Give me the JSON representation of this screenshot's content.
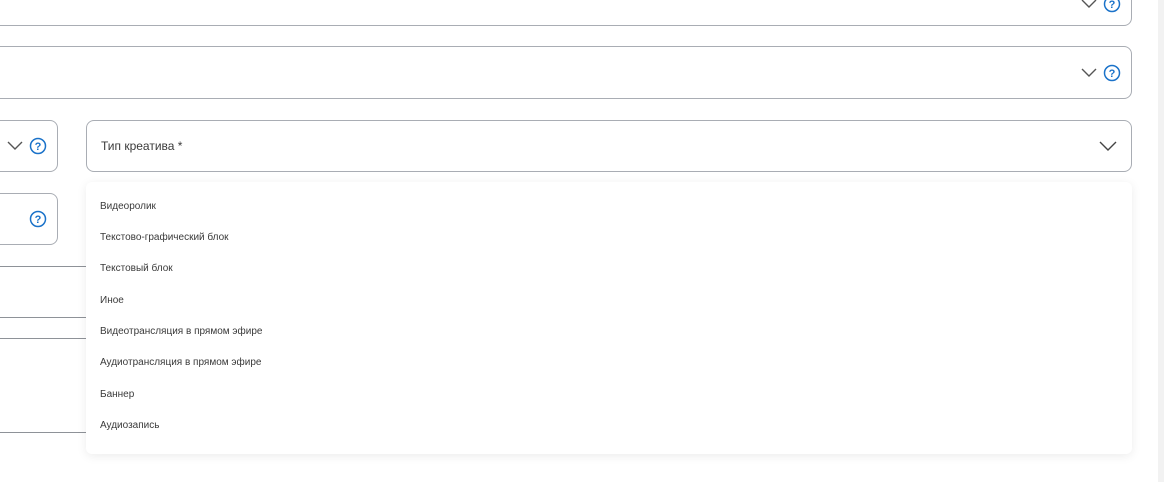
{
  "fields": {
    "top_field_partial": {
      "label": ""
    },
    "second_field": {
      "label": ""
    },
    "left_select_field": {
      "label": ""
    },
    "left_input_field": {
      "label": ""
    },
    "creative_type": {
      "label": "Тип креатива *"
    }
  },
  "dropdown": {
    "options": [
      "Видеоролик",
      "Текстово-графический блок",
      "Текстовый блок",
      "Иное",
      "Видеотрансляция в прямом эфире",
      "Аудиотрансляция в прямом эфире",
      "Баннер",
      "Аудиозапись"
    ]
  },
  "icons": {
    "chevron": "chevron-down-icon",
    "help": "help-icon"
  },
  "colors": {
    "border": "#a9adb4",
    "help": "#1a72c9",
    "text": "#3a3a3a"
  }
}
